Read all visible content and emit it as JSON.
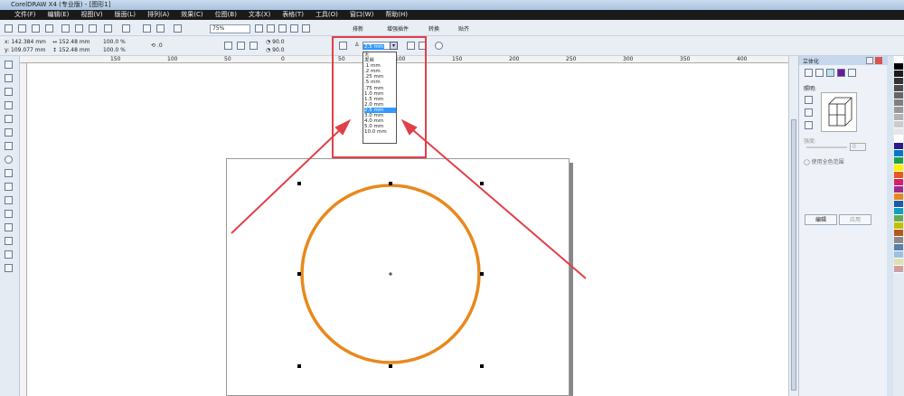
{
  "window": {
    "title": "CorelDRAW X4 (专业版) - [图形1]"
  },
  "menu": [
    "文件(F)",
    "编辑(E)",
    "视图(V)",
    "版面(L)",
    "排列(A)",
    "效果(C)",
    "位图(B)",
    "文本(X)",
    "表格(T)",
    "工具(O)",
    "窗口(W)",
    "帮助(H)"
  ],
  "toolbar": {
    "zoom": "75%",
    "plugins": [
      "排新",
      "增强插件",
      "转换",
      "贴齐"
    ]
  },
  "property_bar": {
    "x": "142.384 mm",
    "y": "109.077 mm",
    "width": "152.48 mm",
    "height": "152.48 mm",
    "scale_x": "100.0",
    "scale_y": "100.0",
    "percent": "%",
    "rotation": ".0",
    "angle1": "90.0",
    "angle2": "90.0",
    "outline_width": "2.5 mm"
  },
  "outline_dropdown": {
    "options": [
      "无",
      "发丝",
      ".1 mm",
      ".2 mm",
      ".25 mm",
      ".5 mm",
      ".75 mm",
      "1.0 mm",
      "1.5 mm",
      "2.0 mm",
      "2.5 mm",
      "3.0 mm",
      "4.0 mm",
      "5.0 mm",
      "10.0 mm"
    ],
    "selected": "2.5 mm"
  },
  "ruler": {
    "labels": [
      "150",
      "100",
      "50",
      "0",
      "50",
      "100",
      "150",
      "200",
      "250",
      "300",
      "350",
      "400",
      "450"
    ]
  },
  "docker": {
    "title": "立体化",
    "lighting_label": "照明:",
    "intensity_label": "强度:",
    "intensity_value": "0",
    "full_color_label": "使用全色范围",
    "edit_button": "编辑",
    "apply_button": "应用"
  },
  "colors": {
    "circle_outline": "#e8891c",
    "annotation": "#e04048"
  },
  "palette": [
    "#ffffff",
    "#000000",
    "#1a1a1a",
    "#333333",
    "#4d4d4d",
    "#666666",
    "#808080",
    "#999999",
    "#b3b3b3",
    "#cccccc",
    "#e6e6e6",
    "#ffffff",
    "#2b1a8a",
    "#0077cc",
    "#1e9e4a",
    "#ffee00",
    "#e8591c",
    "#d81f6b",
    "#9b2b8f",
    "#e8891c",
    "#1a5ca8",
    "#0fa0c0",
    "#6aa84f",
    "#c0c000",
    "#b05a20",
    "#8a8a8a",
    "#5b7fa6",
    "#a0c0e0",
    "#e0e0b0",
    "#d0a0a0"
  ]
}
